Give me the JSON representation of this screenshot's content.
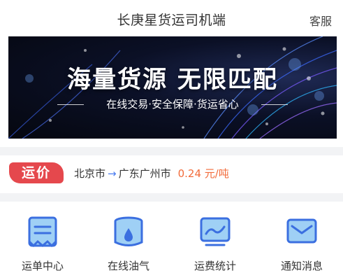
{
  "header": {
    "title": "长庚星货运司机端",
    "service_label": "客服"
  },
  "banner": {
    "headline": "海量货源  无限匹配",
    "tagline": "在线交易·安全保障·货运省心"
  },
  "rate": {
    "badge": "运价",
    "origin": "北京市",
    "destination": "广东广州市",
    "price": "0.24 元/吨"
  },
  "menu": {
    "items": [
      {
        "label": "运单中心",
        "icon": "waybill-icon"
      },
      {
        "label": "在线油气",
        "icon": "fuel-icon"
      },
      {
        "label": "运费统计",
        "icon": "statistics-icon"
      },
      {
        "label": "通知消息",
        "icon": "message-icon"
      }
    ]
  },
  "colors": {
    "accent_blue": "#4a7cf0",
    "badge_red": "#e5484d",
    "price_orange": "#f26b3a"
  }
}
